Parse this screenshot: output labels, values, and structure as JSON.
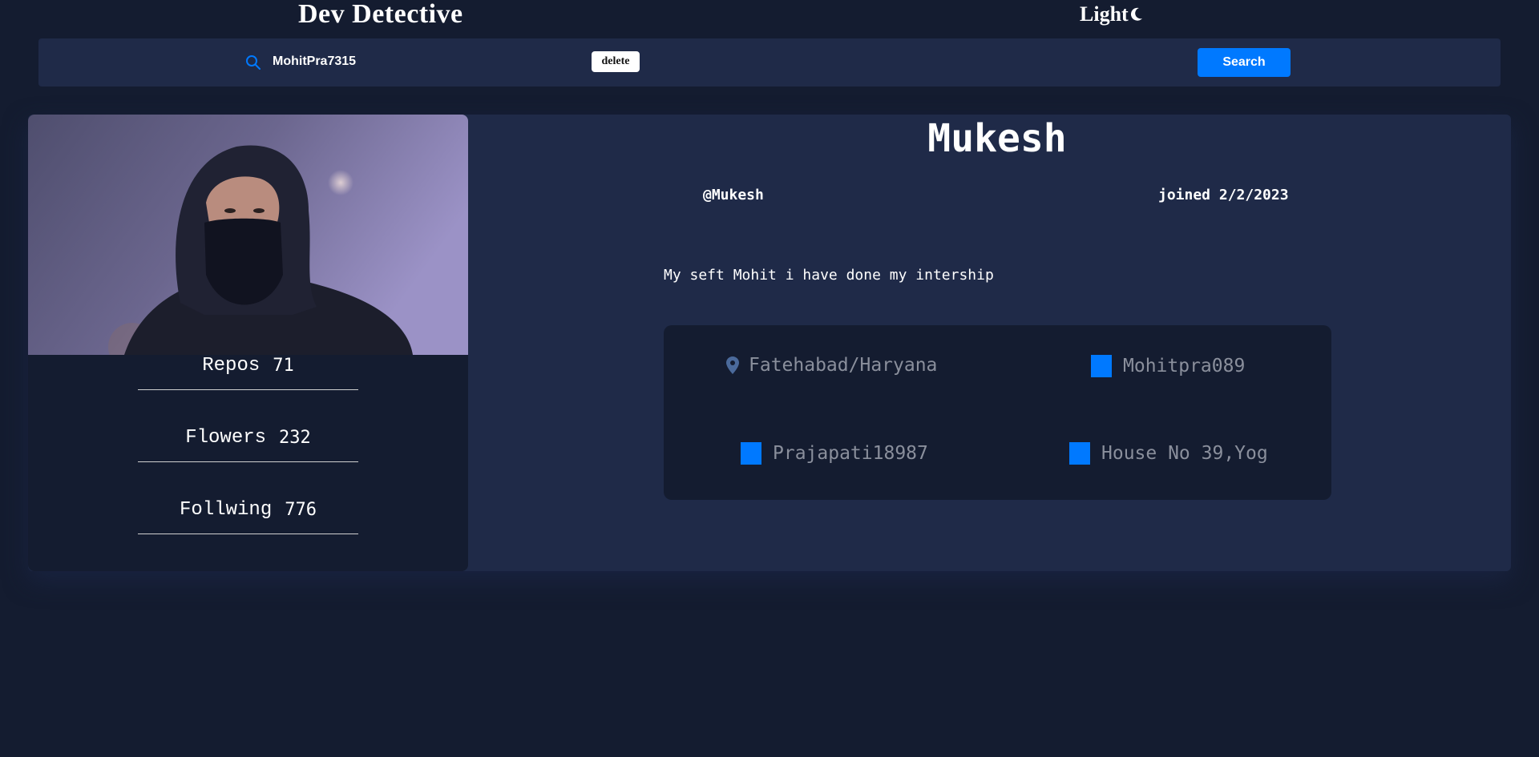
{
  "header": {
    "brand": "Dev Detective",
    "theme_toggle_label": "Light",
    "theme_icon": "moon-icon"
  },
  "search": {
    "icon": "search-icon",
    "value": "MohitPra7315",
    "delete_label": "delete",
    "button_label": "Search"
  },
  "profile": {
    "name": "Mukesh",
    "username": "@Mukesh",
    "joined": "joined 2/2/2023",
    "bio": "My seft Mohit i have done my intership",
    "stats": [
      {
        "label": "Repos",
        "value": "71"
      },
      {
        "label": "Flowers",
        "value": "232"
      },
      {
        "label": "Follwing",
        "value": "776"
      }
    ],
    "links": {
      "location": {
        "icon": "location-pin-icon",
        "text": "Fatehabad/Haryana"
      },
      "website": {
        "icon": "blue-square-icon",
        "text": "Mohitpra089"
      },
      "twitter": {
        "icon": "blue-square-icon",
        "text": "Prajapati18987"
      },
      "company": {
        "icon": "blue-square-icon",
        "text": "House No 39,Yog"
      }
    }
  },
  "colors": {
    "page_bg": "#141c30",
    "card_bg": "#1f2a48",
    "accent": "#0079ff"
  }
}
